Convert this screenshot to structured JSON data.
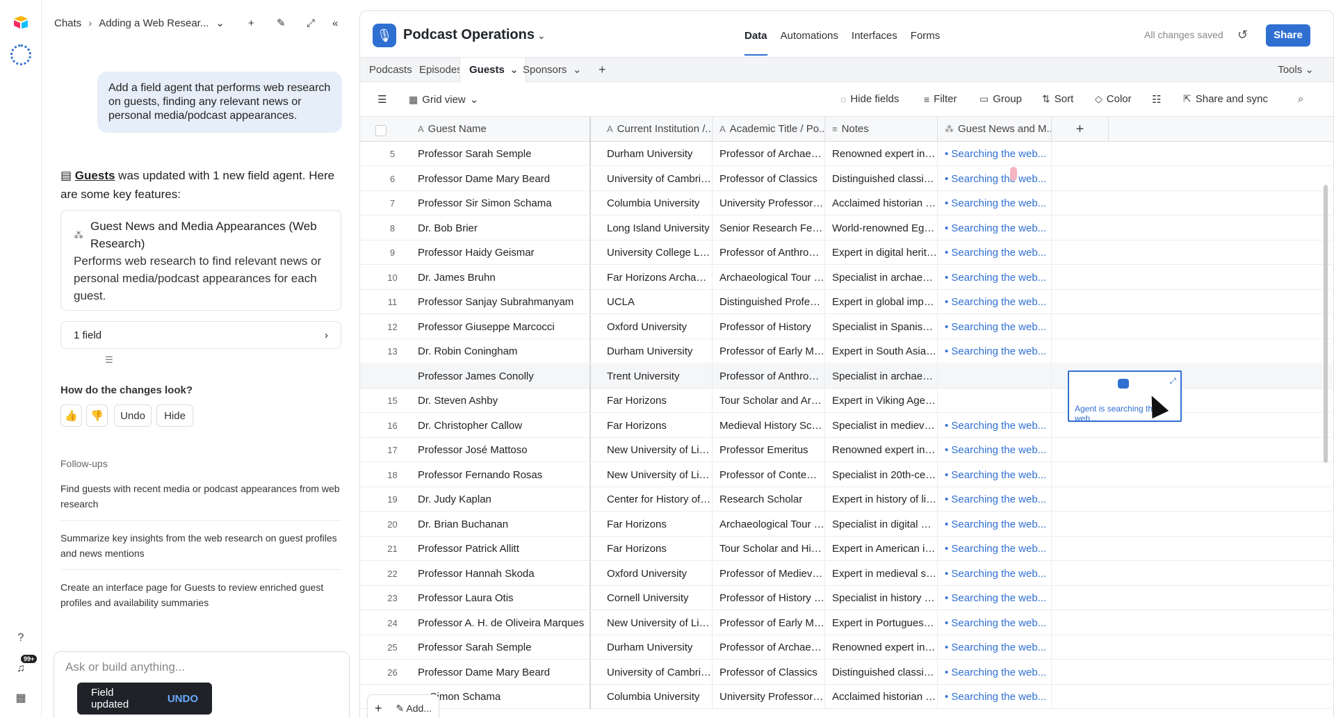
{
  "chat": {
    "breadcrumb_root": "Chats",
    "breadcrumb_current": "Adding a Web Resear...",
    "user_message": "Add a field agent that performs web research on guests, finding any relevant news or personal media/podcast appearances.",
    "reply_table": "Guests",
    "reply_text": " was updated with 1 new field agent. Here are some key features:",
    "card_title": "Guest News and Media Appearances (Web Research)",
    "card_desc": "Performs web research to find relevant news or personal media/podcast appearances for each guest.",
    "field_count": "1 field",
    "question": "How do the changes look?",
    "undo": "Undo",
    "hide": "Hide",
    "followups_header": "Follow-ups",
    "followups": [
      "Find guests with recent media or podcast appearances from web research",
      "Summarize key insights from the web research on guest profiles and news mentions",
      "Create an interface page for Guests to review enriched guest profiles and availability summaries"
    ],
    "ask_placeholder": "Ask or build anything...",
    "toast_text": "Field updated",
    "toast_undo": "UNDO",
    "notif_badge": "99+"
  },
  "base": {
    "title": "Podcast Operations",
    "nav": [
      "Data",
      "Automations",
      "Interfaces",
      "Forms"
    ],
    "saved": "All changes saved",
    "share": "Share",
    "tables": [
      "Podcasts",
      "Episodes",
      "Guests",
      "Sponsors"
    ],
    "tools": "Tools",
    "view": "Grid view",
    "toolbar": [
      "Hide fields",
      "Filter",
      "Group",
      "Sort",
      "Color",
      "Share and sync"
    ]
  },
  "grid": {
    "columns": [
      "Guest Name",
      "Current Institution /...",
      "Academic Title / Po...",
      "Notes",
      "Guest News and M..."
    ],
    "rows": [
      {
        "n": "5",
        "name": "Professor Sarah Semple",
        "inst": "Durham University",
        "title": "Professor of Archaeology",
        "notes": "Renowned expert in medi...",
        "web": "Searching the web..."
      },
      {
        "n": "6",
        "name": "Professor Dame Mary Beard",
        "inst": "University of Cambridge",
        "title": "Professor of Classics",
        "notes": "Distinguished classicist a...",
        "web": "Searching the web..."
      },
      {
        "n": "7",
        "name": "Professor Sir Simon Schama",
        "inst": "Columbia University",
        "title": "University Professor of Ar...",
        "notes": "Acclaimed historian and b...",
        "web": "Searching the web..."
      },
      {
        "n": "8",
        "name": "Dr. Bob Brier",
        "inst": "Long Island University",
        "title": "Senior Research Fellow",
        "notes": "World-renowned Egyptol...",
        "web": "Searching the web..."
      },
      {
        "n": "9",
        "name": "Professor Haidy Geismar",
        "inst": "University College London",
        "title": "Professor of Anthropology",
        "notes": "Expert in digital heritage ...",
        "web": "Searching the web..."
      },
      {
        "n": "10",
        "name": "Dr. James Bruhn",
        "inst": "Far Horizons Archaeologi...",
        "title": "Archaeological Tour Scho...",
        "notes": "Specialist in archaeologic...",
        "web": "Searching the web..."
      },
      {
        "n": "11",
        "name": "Professor Sanjay Subrahmanyam",
        "inst": "UCLA",
        "title": "Distinguished Professor o...",
        "notes": "Expert in global imperial h...",
        "web": "Searching the web..."
      },
      {
        "n": "12",
        "name": "Professor Giuseppe Marcocci",
        "inst": "Oxford University",
        "title": "Professor of History",
        "notes": "Specialist in Spanish and ...",
        "web": "Searching the web..."
      },
      {
        "n": "13",
        "name": "Dr. Robin Coningham",
        "inst": "Durham University",
        "title": "Professor of Early Mediev...",
        "notes": "Expert in South Asian arc...",
        "web": "Searching the web..."
      },
      {
        "n": "",
        "name": "Professor James Conolly",
        "inst": "Trent University",
        "title": "Professor of Anthropology",
        "notes": "Specialist in archaeologic...",
        "web": ""
      },
      {
        "n": "15",
        "name": "Dr. Steven Ashby",
        "inst": "Far Horizons",
        "title": "Tour Scholar and Archaeo...",
        "notes": "Expert in Viking Age arch...",
        "web": ""
      },
      {
        "n": "16",
        "name": "Dr. Christopher Callow",
        "inst": "Far Horizons",
        "title": "Medieval History Scholar",
        "notes": "Specialist in medieval Sca...",
        "web": "Searching the web..."
      },
      {
        "n": "17",
        "name": "Professor José Mattoso",
        "inst": "New University of Lisbon",
        "title": "Professor Emeritus",
        "notes": "Renowned expert in medi...",
        "web": "Searching the web..."
      },
      {
        "n": "18",
        "name": "Professor Fernando Rosas",
        "inst": "New University of Lisbon",
        "title": "Professor of Contempora...",
        "notes": "Specialist in 20th-century...",
        "web": "Searching the web..."
      },
      {
        "n": "19",
        "name": "Dr. Judy Kaplan",
        "inst": "Center for History of Scie...",
        "title": "Research Scholar",
        "notes": "Expert in history of lingui...",
        "web": "Searching the web..."
      },
      {
        "n": "20",
        "name": "Dr. Brian Buchanan",
        "inst": "Far Horizons",
        "title": "Archaeological Tour Scho...",
        "notes": "Specialist in digital metho...",
        "web": "Searching the web..."
      },
      {
        "n": "21",
        "name": "Professor Patrick Allitt",
        "inst": "Far Horizons",
        "title": "Tour Scholar and History ...",
        "notes": "Expert in American intelle...",
        "web": "Searching the web..."
      },
      {
        "n": "22",
        "name": "Professor Hannah Skoda",
        "inst": "Oxford University",
        "title": "Professor of Medieval His...",
        "notes": "Expert in medieval social ...",
        "web": "Searching the web..."
      },
      {
        "n": "23",
        "name": "Professor Laura Otis",
        "inst": "Cornell University",
        "title": "Professor of History of Sc...",
        "notes": "Specialist in history of sci...",
        "web": "Searching the web..."
      },
      {
        "n": "24",
        "name": "Professor A. H. de Oliveira Marques",
        "inst": "New University of Lisbon",
        "title": "Professor of Early Moder...",
        "notes": "Expert in Portuguese and ...",
        "web": "Searching the web..."
      },
      {
        "n": "25",
        "name": "Professor Sarah Semple",
        "inst": "Durham University",
        "title": "Professor of Archaeology",
        "notes": "Renowned expert in medi...",
        "web": "Searching the web..."
      },
      {
        "n": "26",
        "name": "Professor Dame Mary Beard",
        "inst": "University of Cambridge",
        "title": "Professor of Classics",
        "notes": "Distinguished classicist a...",
        "web": "Searching the web..."
      },
      {
        "n": "",
        "name": "or Simon Schama",
        "inst": "Columbia University",
        "title": "University Professor of Ar...",
        "notes": "Acclaimed historian and b...",
        "web": "Searching the web..."
      }
    ],
    "agent_status": "Agent is searching the web...",
    "add_label": "Add..."
  }
}
